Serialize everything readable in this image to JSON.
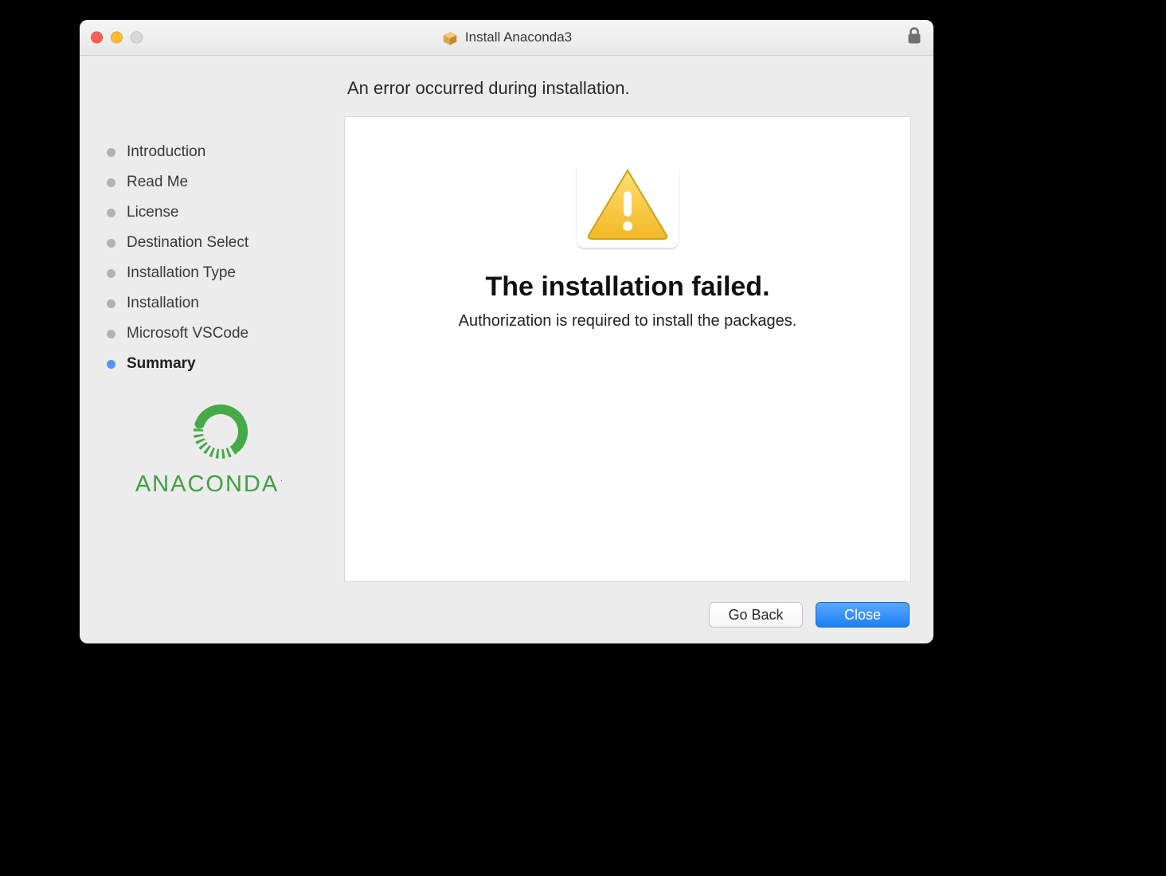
{
  "window": {
    "title": "Install Anaconda3"
  },
  "subtitle": "An error occurred during installation.",
  "steps": [
    {
      "label": "Introduction",
      "current": false
    },
    {
      "label": "Read Me",
      "current": false
    },
    {
      "label": "License",
      "current": false
    },
    {
      "label": "Destination Select",
      "current": false
    },
    {
      "label": "Installation Type",
      "current": false
    },
    {
      "label": "Installation",
      "current": false
    },
    {
      "label": "Microsoft VSCode",
      "current": false
    },
    {
      "label": "Summary",
      "current": true
    }
  ],
  "brand": {
    "name": "ANACONDA"
  },
  "panel": {
    "heading": "The installation failed.",
    "message": "Authorization is required to install the packages."
  },
  "buttons": {
    "back": "Go Back",
    "close": "Close"
  }
}
